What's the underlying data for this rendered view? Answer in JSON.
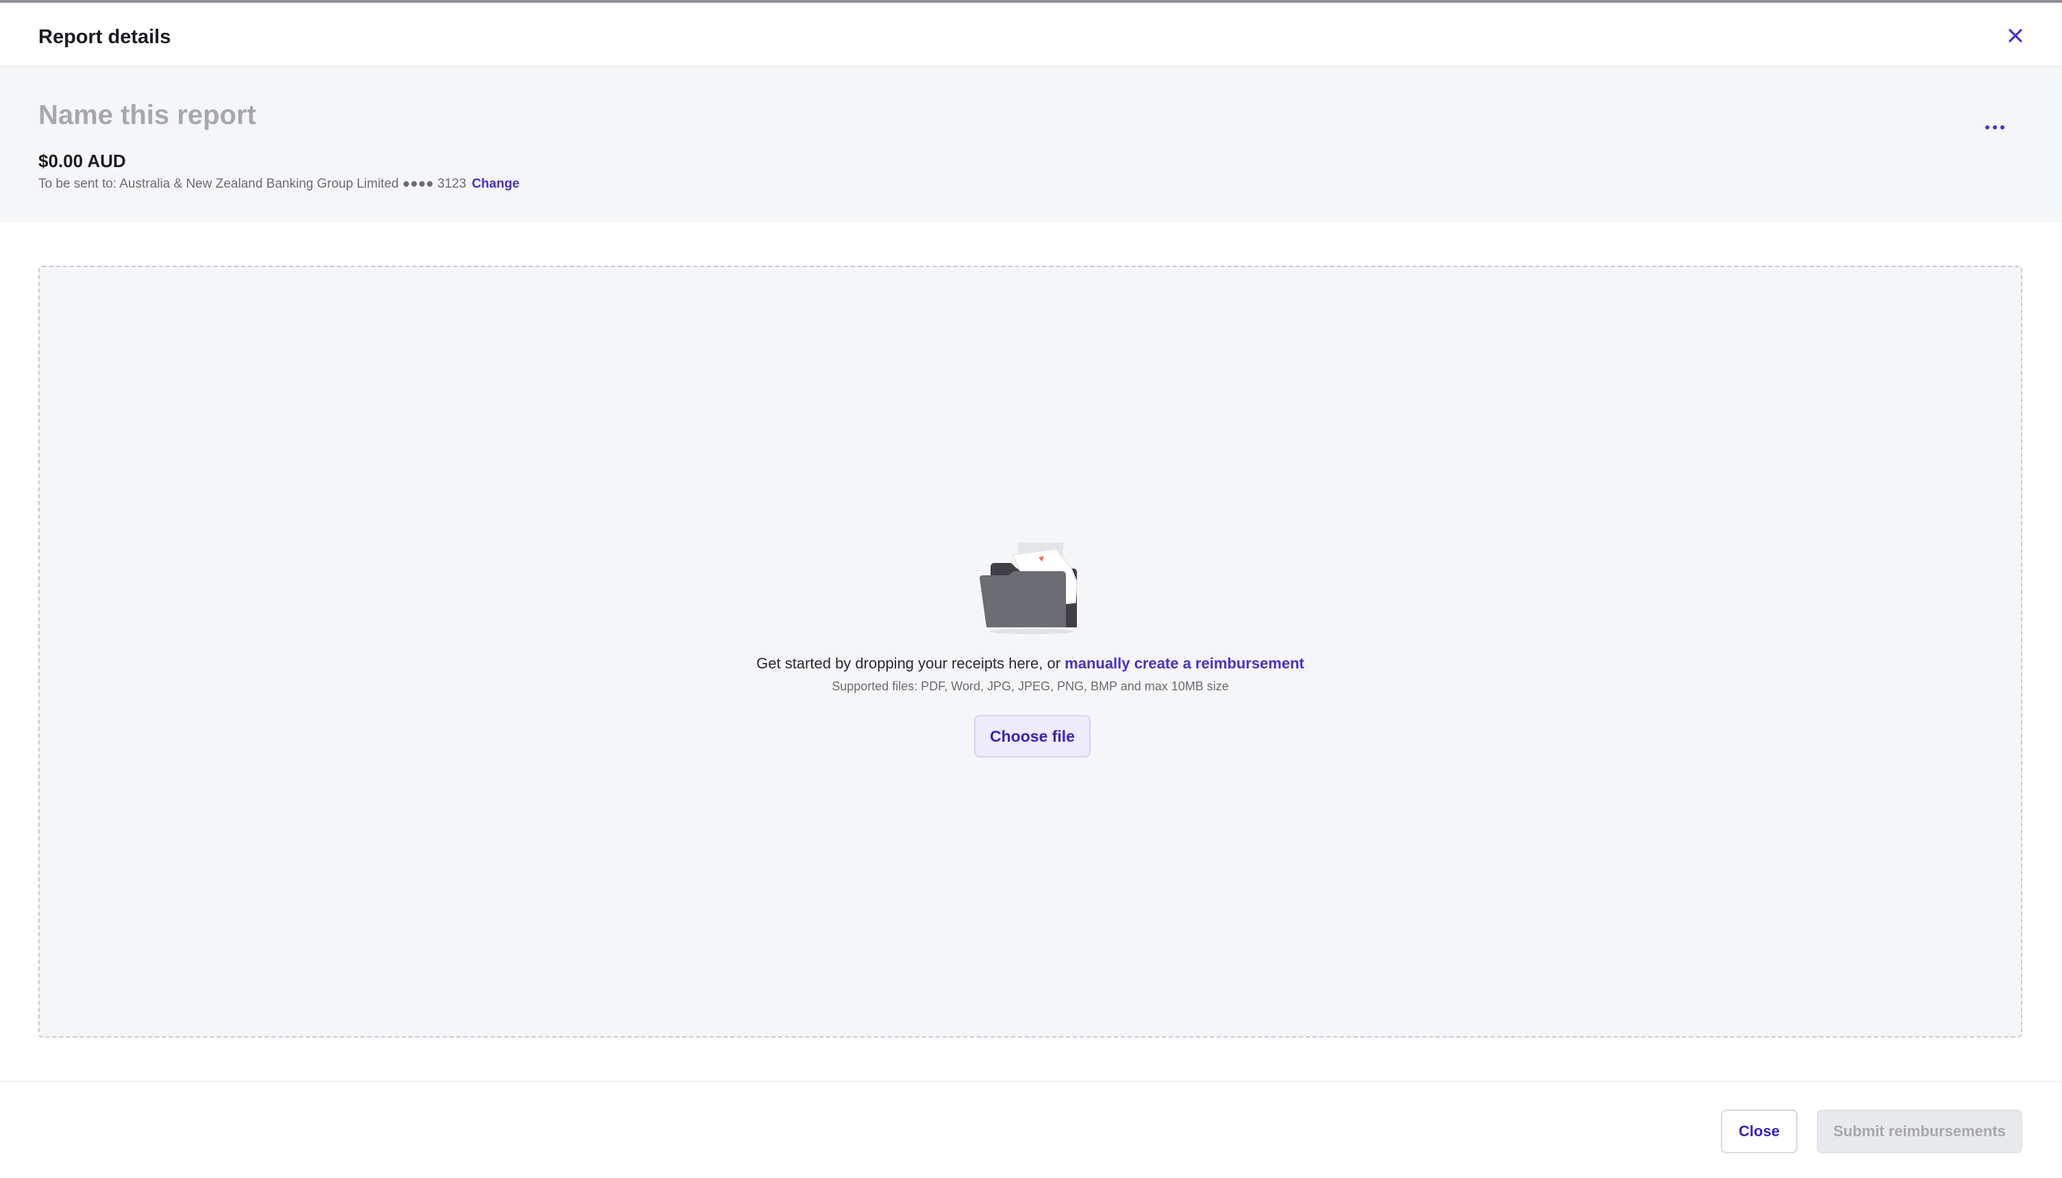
{
  "header": {
    "title": "Report details",
    "close_icon": "close-icon"
  },
  "summary": {
    "name_placeholder": "Name this report",
    "amount": "$0.00 AUD",
    "sent_to_prefix": "To be sent to: Australia & New Zealand Banking Group Limited ●●●● 3123",
    "change_label": "Change",
    "more_icon": "more-horizontal-icon"
  },
  "dropzone": {
    "illustration_icon": "folder-icon",
    "text_prefix": "Get started by dropping your receipts here, or ",
    "manual_link": "manually create a reimbursement",
    "supported_files": "Supported files: PDF, Word, JPG, JPEG, PNG, BMP and max 10MB size",
    "choose_file_label": "Choose file"
  },
  "footer": {
    "close_label": "Close",
    "submit_label": "Submit reimbursements"
  },
  "colors": {
    "accent": "#4a2fc9",
    "panel_bg": "#f5f6f8",
    "muted_text": "#a7a8ae"
  }
}
